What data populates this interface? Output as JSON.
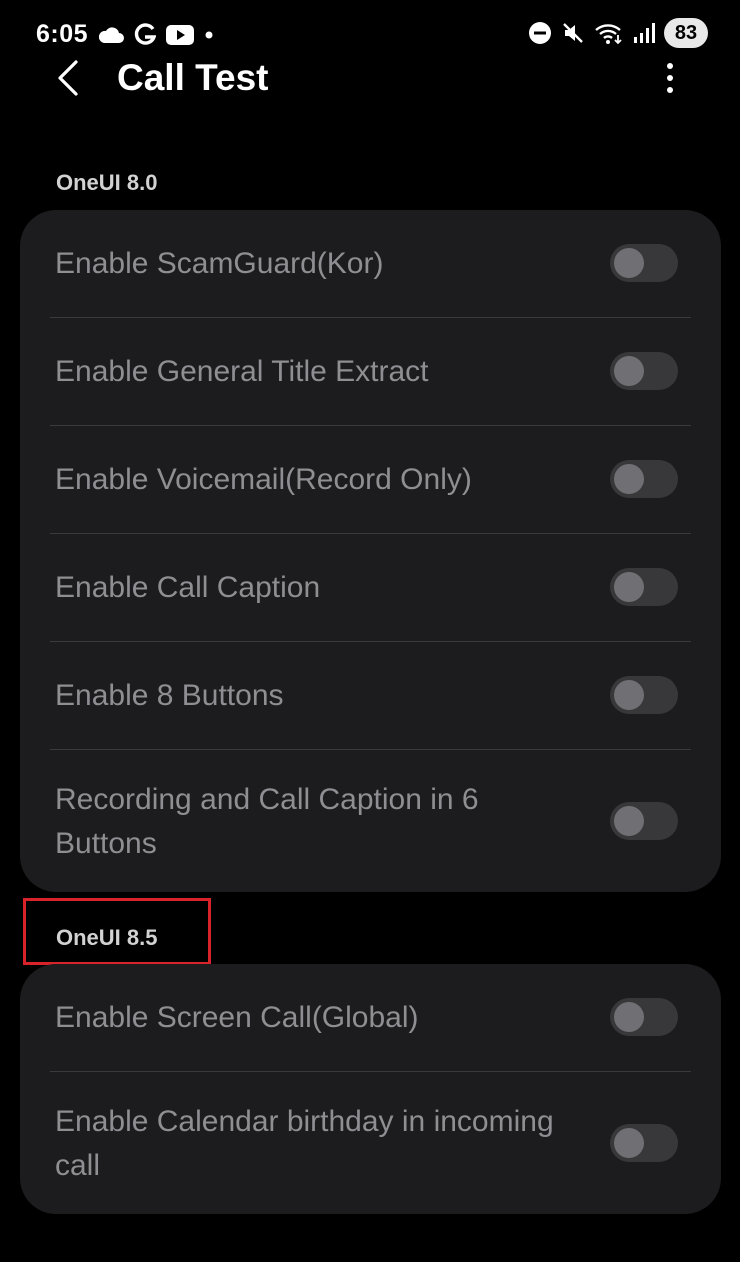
{
  "status_bar": {
    "time": "6:05",
    "left_icons": [
      "cloud-icon",
      "google-g-icon",
      "youtube-icon",
      "dot-icon"
    ],
    "right_icons": [
      "do-not-disturb-icon",
      "mute-icon",
      "wifi-icon",
      "signal-icon"
    ],
    "battery": "83"
  },
  "app_bar": {
    "title": "Call Test",
    "back_icon": "chevron-left-icon",
    "more_icon": "more-vert-icon"
  },
  "sections": [
    {
      "header": "OneUI 8.0",
      "items": [
        {
          "label": "Enable ScamGuard(Kor)",
          "enabled": false
        },
        {
          "label": "Enable General Title Extract",
          "enabled": false
        },
        {
          "label": "Enable Voicemail(Record Only)",
          "enabled": false
        },
        {
          "label": "Enable Call Caption",
          "enabled": false
        },
        {
          "label": "Enable 8 Buttons",
          "enabled": false
        },
        {
          "label": "Recording and Call Caption in 6 Buttons",
          "enabled": false
        }
      ]
    },
    {
      "header": "OneUI 8.5",
      "highlighted": true,
      "highlight_color": "#d8232a",
      "items": [
        {
          "label": "Enable Screen Call(Global)",
          "enabled": false
        },
        {
          "label": "Enable Calendar birthday in incoming call",
          "enabled": false
        }
      ]
    }
  ],
  "colors": {
    "background": "#000000",
    "card": "#1c1c1e",
    "label_disabled": "#8e8e93",
    "toggle_track": "#38383b",
    "toggle_knob": "#707074"
  }
}
